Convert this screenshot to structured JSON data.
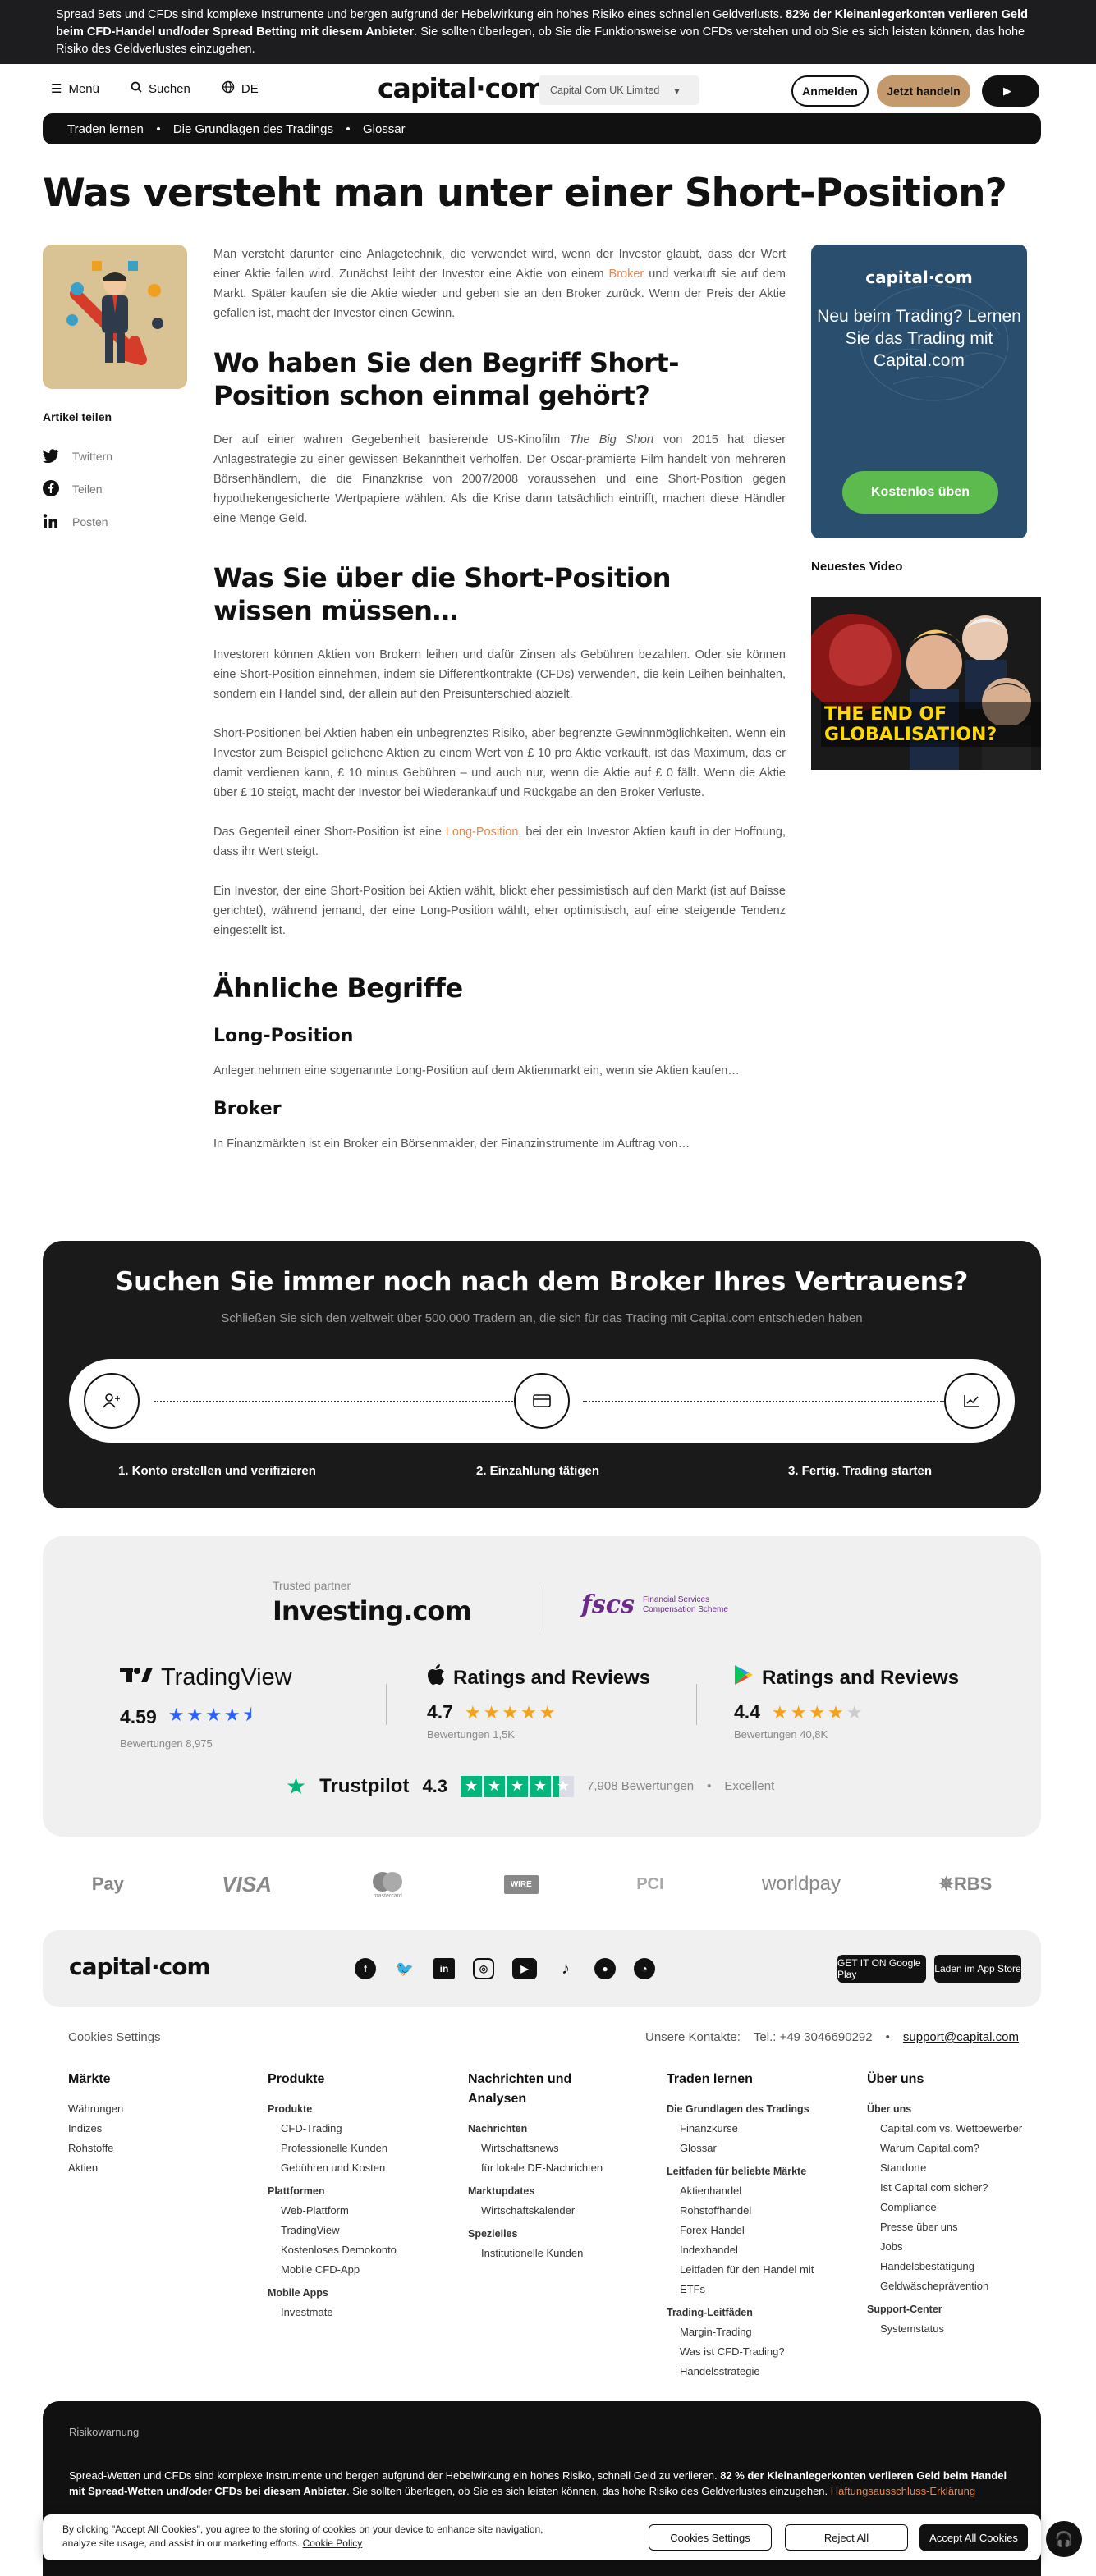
{
  "risk_top": {
    "text_normal": "Spread Bets und CFDs sind komplexe Instrumente und bergen aufgrund der Hebelwirkung ein hohes Risiko eines schnellen Geldverlusts. ",
    "text_bold": "82% der Kleinanlegerkonten verlieren Geld beim CFD-Handel und/oder Spread Betting mit diesem Anbieter",
    "text_tail": ". Sie sollten überlegen, ob Sie die Funktionsweise von CFDs verstehen und ob Sie es sich leisten können, das hohe Risiko des Geldverlustes einzugehen."
  },
  "header": {
    "menu_label": "Menü",
    "search_label": "Suchen",
    "language": "DE",
    "logo": "capital·com",
    "entity": "Capital Com UK Limited",
    "login": "Anmelden",
    "trade": "Jetzt handeln"
  },
  "breadcrumb": [
    "Traden lernen",
    "Die Grundlagen des Tradings",
    "Glossar"
  ],
  "title": "Was versteht man unter einer Short-Position?",
  "share": {
    "title": "Artikel teilen",
    "items": [
      "Twittern",
      "Teilen",
      "Posten"
    ]
  },
  "article": {
    "intro_a": "Man versteht darunter eine Anlagetechnik, die verwendet wird, wenn der Investor glaubt, dass der Wert einer Aktie fallen wird. Zunächst leiht der Investor eine Aktie von einem ",
    "intro_link": "Broker",
    "intro_b": " und verkauft sie auf dem Markt. Später kaufen sie die Aktie wieder und geben sie an den Broker zurück. Wenn der Preis der Aktie gefallen ist, macht der Investor einen Gewinn.",
    "h2_1": "Wo haben Sie den Begriff Short-Position schon einmal gehört?",
    "p2_a": "Der auf einer wahren Gegebenheit basierende US-Kinofilm ",
    "p2_em": "The Big Short",
    "p2_b": " von 2015 hat dieser Anlagestrategie zu einer gewissen Bekanntheit verholfen. Der Oscar-prämierte Film handelt von mehreren Börsenhändlern, die die Finanzkrise von 2007/2008 voraussehen und eine Short-Position gegen hypothekengesicherte Wertpapiere wählen. Als die Krise dann tatsächlich eintrifft, machen diese Händler eine Menge Geld.",
    "h2_2": "Was Sie über die Short-Position wissen müssen…",
    "p3": "Investoren können Aktien von Brokern leihen und dafür Zinsen als Gebühren bezahlen. Oder sie können eine Short-Position einnehmen, indem sie Differentkontrakte (CFDs) verwenden, die kein Leihen beinhalten, sondern ein Handel sind, der allein auf den Preisunterschied abzielt.",
    "p4": "Short-Positionen bei Aktien haben ein unbegrenztes Risiko, aber begrenzte Gewinnmöglichkeiten. Wenn ein Investor zum Beispiel geliehene Aktien zu einem Wert von £ 10 pro Aktie verkauft, ist das Maximum, das er damit verdienen kann, £ 10 minus Gebühren – und auch nur, wenn die Aktie auf £ 0 fällt. Wenn die Aktie über £ 10 steigt, macht der Investor bei Wiederankauf und Rückgabe an den Broker Verluste.",
    "p5_a": "Das Gegenteil einer Short-Position ist eine ",
    "p5_link": "Long-Position",
    "p5_b": ", bei der ein Investor Aktien kauft in der Hoffnung, dass ihr Wert steigt.",
    "p6": "Ein Investor, der eine Short-Position bei Aktien wählt, blickt eher pessimistisch auf den Markt (ist auf Baisse gerichtet), während jemand, der eine Long-Position wählt, eher optimistisch, auf eine steigende Tendenz eingestellt ist.",
    "h2_3": "Ähnliche Begriffe",
    "rel1_title": "Long-Position",
    "rel1_text": "Anleger nehmen eine sogenannte Long-Position auf dem Aktienmarkt ein, wenn sie Aktien kaufen…",
    "rel2_title": "Broker",
    "rel2_text": "In Finanzmärkten ist ein Broker ein Börsenmakler, der Finanzinstrumente im Auftrag von…"
  },
  "promo": {
    "logo": "capital·com",
    "text": "Neu beim Trading? Lernen Sie das Trading mit Capital.com",
    "button": "Kostenlos üben"
  },
  "video": {
    "title": "Neuestes Video",
    "caption": "THE END OF GLOBALISATION?"
  },
  "broker_box": {
    "title": "Suchen Sie immer noch nach dem Broker Ihres Vertrauens?",
    "subtitle": "Schließen Sie sich den weltweit über 500.000 Tradern an, die sich für das Trading mit Capital.com entschieden haben",
    "steps": [
      "1. Konto erstellen und verifizieren",
      "2. Einzahlung tätigen",
      "3. Fertig. Trading starten"
    ]
  },
  "trust": {
    "partner_label": "Trusted partner",
    "partner_name": "Investing.com",
    "fscs_logo": "fscs",
    "fscs_text1": "Financial Services",
    "fscs_text2": "Compensation Scheme",
    "ratings": [
      {
        "name": "TradingView",
        "score": "4.59",
        "count": "Bewertungen 8,975",
        "stars": 4.5
      },
      {
        "name": "Ratings and Reviews",
        "score": "4.7",
        "count": "Bewertungen 1,5K",
        "stars": 4.7
      },
      {
        "name": "Ratings and Reviews",
        "score": "4.4",
        "count": "Bewertungen 40,8K",
        "stars": 4.4
      }
    ],
    "trustpilot_name": "Trustpilot",
    "trustpilot_score": "4.3",
    "trustpilot_count": "7,908 Bewertungen",
    "trustpilot_label": "Excellent"
  },
  "payments": [
    "Pay",
    "VISA",
    "mastercard",
    "WIRE",
    "PCI",
    "worldpay",
    "RBS"
  ],
  "footer": {
    "logo": "capital·com",
    "social": [
      "f",
      "t",
      "in",
      "ig",
      "yt",
      "tk",
      "rd",
      "rs"
    ],
    "google_play": "GET IT ON Google Play",
    "app_store": "Laden im App Store",
    "cookie_settings": "Cookies Settings",
    "contact_label": "Unsere Kontakte:",
    "phone": "Tel.: +49 3046690292",
    "email": "support@capital.com",
    "columns": [
      {
        "title": "Märkte",
        "items": [
          [
            "",
            "Währungen"
          ],
          [
            "",
            "Indizes"
          ],
          [
            "",
            "Rohstoffe"
          ],
          [
            "",
            "Aktien"
          ]
        ]
      },
      {
        "title": "Produkte",
        "items": [
          [
            "sub",
            "Produkte"
          ],
          [
            "i",
            "CFD-Trading"
          ],
          [
            "i",
            "Professionelle Kunden"
          ],
          [
            "i",
            "Gebühren und Kosten"
          ],
          [
            "sub",
            "Plattformen"
          ],
          [
            "i",
            "Web-Plattform"
          ],
          [
            "i",
            "TradingView"
          ],
          [
            "i",
            "Kostenloses Demokonto"
          ],
          [
            "i",
            "Mobile CFD-App"
          ],
          [
            "sub",
            "Mobile Apps"
          ],
          [
            "i",
            "Investmate"
          ]
        ]
      },
      {
        "title": "Nachrichten und Analysen",
        "items": [
          [
            "sub",
            "Nachrichten"
          ],
          [
            "i",
            "Wirtschaftsnews"
          ],
          [
            "i",
            "für lokale DE-Nachrichten"
          ],
          [
            "sub",
            "Marktupdates"
          ],
          [
            "i",
            "Wirtschaftskalender"
          ],
          [
            "sub",
            "Speziell­es"
          ],
          [
            "i",
            "Institutionelle Kunden"
          ]
        ]
      },
      {
        "title": "Traden lernen",
        "items": [
          [
            "sub",
            "Die Grundlagen des Tradings"
          ],
          [
            "i",
            "Finanzkurse"
          ],
          [
            "i",
            "Glossar"
          ],
          [
            "sub",
            "Leitfaden für beliebte Märkte"
          ],
          [
            "i",
            "Aktienhandel"
          ],
          [
            "i",
            "Rohstoffhandel"
          ],
          [
            "i",
            "Forex-Handel"
          ],
          [
            "i",
            "Indexhandel"
          ],
          [
            "i",
            "Leitfaden für den Handel mit ETFs"
          ],
          [
            "sub",
            "Trading-Leitfäden"
          ],
          [
            "i",
            "Margin-Trading"
          ],
          [
            "i",
            "Was ist CFD-Trading?"
          ],
          [
            "i",
            "Handelsstrategie"
          ]
        ]
      },
      {
        "title": "Über uns",
        "items": [
          [
            "sub",
            "Über uns"
          ],
          [
            "i",
            "Capital.com vs. Wettbewerber"
          ],
          [
            "i",
            "Warum Capital.com?"
          ],
          [
            "i",
            "Standorte"
          ],
          [
            "i",
            "Ist Capital.com sicher?"
          ],
          [
            "i",
            "Compliance"
          ],
          [
            "i",
            "Presse über uns"
          ],
          [
            "i",
            "Jobs"
          ],
          [
            "i",
            "Handelsbestätigung"
          ],
          [
            "i",
            "Geldwäscheprävention"
          ],
          [
            "sub",
            "Support-Center"
          ],
          [
            "i",
            "Systemstatus"
          ]
        ]
      }
    ]
  },
  "risk_bottom": {
    "title": "Risikowarnung",
    "text_a": "Spread-Wetten und CFDs sind komplexe Instrumente und bergen aufgrund der Hebelwirkung ein hohes Risiko, schnell Geld zu verlieren. ",
    "text_bold": "82 % der Kleinanlegerkonten verlieren Geld beim Handel mit Spread-Wetten und/oder CFDs bei diesem Anbieter",
    "text_b": ". Sie sollten überlegen, ob Sie es sich leisten können, das hohe Risiko des Geldverlustes einzugehen. ",
    "text_link": "Haftungsausschluss-Erklärung"
  },
  "cookie_banner": {
    "text": "By clicking \"Accept All Cookies\", you agree to the storing of cookies on your device to enhance site navigation, analyze site usage, and assist in our marketing efforts. ",
    "policy": "Cookie Policy",
    "settings": "Cookies Settings",
    "reject": "Reject All",
    "accept": "Accept All Cookies"
  },
  "colors": {
    "accent": "#e8874a",
    "trade_button": "#c49a6c",
    "promo_bg": "#2a4e6e",
    "promo_button": "#5cbb4c",
    "trustpilot": "#00b67a",
    "star": "#f6a11a",
    "tradingview_star": "#2962ff"
  }
}
